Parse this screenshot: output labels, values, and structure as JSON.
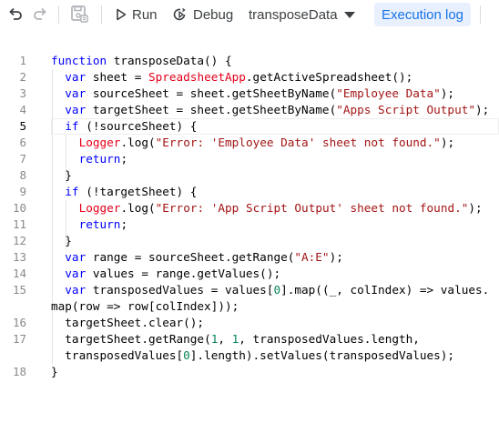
{
  "toolbar": {
    "undo_icon": "undo-icon",
    "redo_icon": "redo-icon",
    "save_icon": "save-icon",
    "run_label": "Run",
    "debug_label": "Debug",
    "function_selected": "transposeData",
    "execution_log_label": "Execution log"
  },
  "editor": {
    "active_line": 5,
    "lines": [
      {
        "num": "1",
        "indent": 0,
        "tokens": [
          [
            "kw",
            "function"
          ],
          [
            "pl",
            " transposeData() {"
          ]
        ]
      },
      {
        "num": "2",
        "indent": 1,
        "tokens": [
          [
            "kw",
            "var"
          ],
          [
            "pl",
            " sheet = "
          ],
          [
            "cls",
            "SpreadsheetApp"
          ],
          [
            "pl",
            ".getActiveSpreadsheet();"
          ]
        ]
      },
      {
        "num": "3",
        "indent": 1,
        "tokens": [
          [
            "kw",
            "var"
          ],
          [
            "pl",
            " sourceSheet = sheet.getSheetByName("
          ],
          [
            "str",
            "\"Employee Data\""
          ],
          [
            "pl",
            ");"
          ]
        ]
      },
      {
        "num": "4",
        "indent": 1,
        "tokens": [
          [
            "kw",
            "var"
          ],
          [
            "pl",
            " targetSheet = sheet.getSheetByName("
          ],
          [
            "str",
            "\"Apps Script Output\""
          ],
          [
            "pl",
            ");"
          ]
        ]
      },
      {
        "num": "5",
        "indent": 1,
        "tokens": [
          [
            "kw",
            "if"
          ],
          [
            "pl",
            " (!sourceSheet) {"
          ]
        ]
      },
      {
        "num": "6",
        "indent": 2,
        "tokens": [
          [
            "cls",
            "Logger"
          ],
          [
            "pl",
            ".log("
          ],
          [
            "str",
            "\"Error: 'Employee Data' sheet not found.\""
          ],
          [
            "pl",
            ");"
          ]
        ]
      },
      {
        "num": "7",
        "indent": 2,
        "tokens": [
          [
            "kw",
            "return"
          ],
          [
            "pl",
            ";"
          ]
        ]
      },
      {
        "num": "8",
        "indent": 1,
        "tokens": [
          [
            "pl",
            "}"
          ]
        ]
      },
      {
        "num": "9",
        "indent": 1,
        "tokens": [
          [
            "kw",
            "if"
          ],
          [
            "pl",
            " (!targetSheet) {"
          ]
        ]
      },
      {
        "num": "10",
        "indent": 2,
        "tokens": [
          [
            "cls",
            "Logger"
          ],
          [
            "pl",
            ".log("
          ],
          [
            "str",
            "\"Error: 'App Script Output' sheet not found.\""
          ],
          [
            "pl",
            ");"
          ]
        ]
      },
      {
        "num": "11",
        "indent": 2,
        "tokens": [
          [
            "kw",
            "return"
          ],
          [
            "pl",
            ";"
          ]
        ]
      },
      {
        "num": "12",
        "indent": 1,
        "tokens": [
          [
            "pl",
            "}"
          ]
        ]
      },
      {
        "num": "13",
        "indent": 1,
        "tokens": [
          [
            "kw",
            "var"
          ],
          [
            "pl",
            " range = sourceSheet.getRange("
          ],
          [
            "str",
            "\"A:E\""
          ],
          [
            "pl",
            ");"
          ]
        ]
      },
      {
        "num": "14",
        "indent": 1,
        "tokens": [
          [
            "kw",
            "var"
          ],
          [
            "pl",
            " values = range.getValues();"
          ]
        ]
      },
      {
        "num": "15",
        "indent": 1,
        "tokens": [
          [
            "kw",
            "var"
          ],
          [
            "pl",
            " transposedValues = values["
          ],
          [
            "num",
            "0"
          ],
          [
            "pl",
            "].map((_, colIndex) => values."
          ]
        ]
      },
      {
        "num": "",
        "indent": 0,
        "tokens": [
          [
            "pl",
            "map(row => row[colIndex]));"
          ]
        ]
      },
      {
        "num": "16",
        "indent": 1,
        "tokens": [
          [
            "pl",
            "targetSheet.clear();"
          ]
        ]
      },
      {
        "num": "17",
        "indent": 1,
        "tokens": [
          [
            "pl",
            "targetSheet.getRange("
          ],
          [
            "num",
            "1"
          ],
          [
            "pl",
            ", "
          ],
          [
            "num",
            "1"
          ],
          [
            "pl",
            ", transposedValues.length,"
          ]
        ]
      },
      {
        "num": "",
        "indent": 1,
        "tokens": [
          [
            "pl",
            "transposedValues["
          ],
          [
            "num",
            "0"
          ],
          [
            "pl",
            "].length).setValues(transposedValues);"
          ]
        ]
      },
      {
        "num": "18",
        "indent": 0,
        "tokens": [
          [
            "pl",
            "}"
          ]
        ]
      }
    ]
  }
}
